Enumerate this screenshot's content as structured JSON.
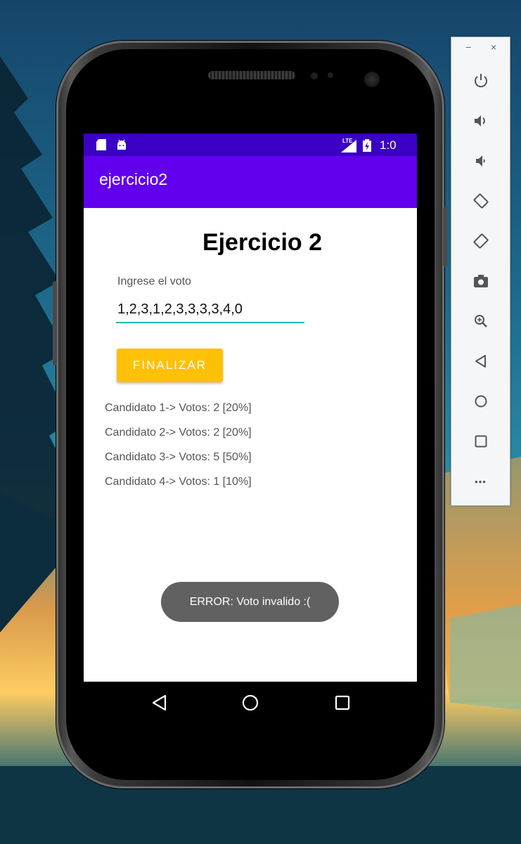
{
  "app": {
    "title": "ejercicio2"
  },
  "status": {
    "time": "1:0",
    "network": "LTE"
  },
  "main": {
    "heading": "Ejercicio 2",
    "input_label": "Ingrese el voto",
    "input_value": "1,2,3,1,2,3,3,3,3,4,0",
    "button_label": "FINALIZAR",
    "results": [
      "Candidato 1-> Votos: 2 [20%]",
      "Candidato 2-> Votos: 2 [20%]",
      "Candidato 3-> Votos: 5 [50%]",
      "Candidato 4-> Votos: 1 [10%]"
    ]
  },
  "toast": {
    "message": "ERROR: Voto invalido :("
  },
  "navbar": {
    "icons": [
      "back-icon",
      "home-icon",
      "overview-icon"
    ]
  },
  "emulator_toolbar": {
    "window_controls": [
      "−",
      "×"
    ],
    "tools": [
      "power-icon",
      "volume-up-icon",
      "volume-down-icon",
      "rotate-left-icon",
      "rotate-right-icon",
      "camera-icon",
      "zoom-icon",
      "back-icon",
      "home-icon",
      "overview-icon",
      "more-icon"
    ],
    "more_label": "•••"
  },
  "colors": {
    "primary": "#6200ee",
    "primary_dark": "#3a00c3",
    "accent": "#ffc107",
    "input_underline": "#1bb8b0",
    "toast": "#616161"
  }
}
